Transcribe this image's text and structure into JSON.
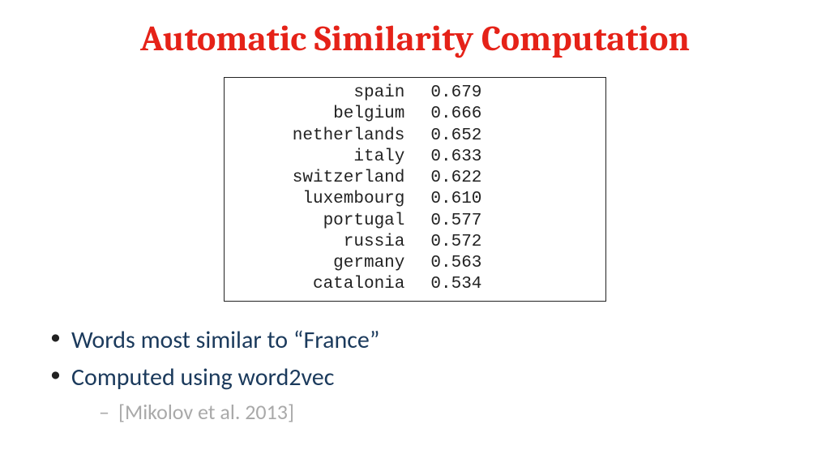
{
  "title": "Automatic Similarity Computation",
  "chart_data": {
    "type": "table",
    "columns": [
      "word",
      "similarity"
    ],
    "rows": [
      {
        "word": "spain",
        "similarity": "0.679"
      },
      {
        "word": "belgium",
        "similarity": "0.666"
      },
      {
        "word": "netherlands",
        "similarity": "0.652"
      },
      {
        "word": "italy",
        "similarity": "0.633"
      },
      {
        "word": "switzerland",
        "similarity": "0.622"
      },
      {
        "word": "luxembourg",
        "similarity": "0.610"
      },
      {
        "word": "portugal",
        "similarity": "0.577"
      },
      {
        "word": "russia",
        "similarity": "0.572"
      },
      {
        "word": "germany",
        "similarity": "0.563"
      },
      {
        "word": "catalonia",
        "similarity": "0.534"
      }
    ]
  },
  "bullets": [
    "Words most similar to “France”",
    "Computed using word2vec"
  ],
  "citation": "[Mikolov et al. 2013]"
}
